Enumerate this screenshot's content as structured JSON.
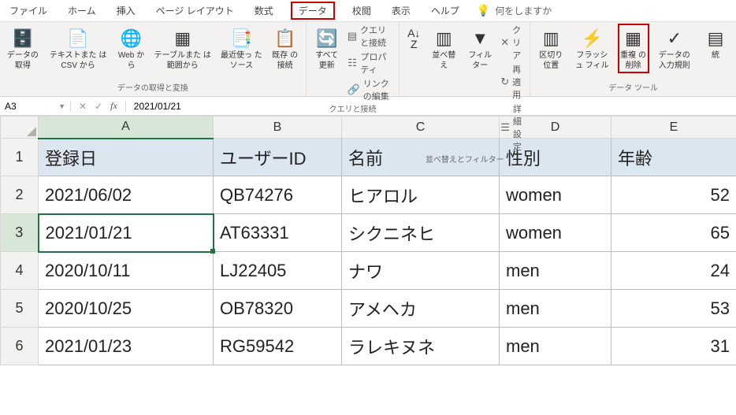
{
  "menu": {
    "file": "ファイル",
    "home": "ホーム",
    "insert": "挿入",
    "pagelayout": "ページ レイアウト",
    "formulas": "数式",
    "data": "データ",
    "review": "校閲",
    "view": "表示",
    "help": "ヘルプ",
    "tellme": "何をしますか"
  },
  "ribbon": {
    "group_getdata": "データの取得と変換",
    "group_queries": "クエリと接続",
    "group_sort": "並べ替えとフィルター",
    "group_tools": "データ ツール",
    "btn_getdata": "データの\n取得",
    "btn_csv": "テキストまた\nは CSV から",
    "btn_web": "Web\nから",
    "btn_table": "テーブルまた\nは範囲から",
    "btn_recent": "最近使っ\nたソース",
    "btn_conn": "既存\nの接続",
    "btn_refresh": "すべて\n更新",
    "btn_q1": "クエリと接続",
    "btn_q2": "プロパティ",
    "btn_q3": "リンクの編集",
    "btn_sort": "並べ替え",
    "btn_filter": "フィルター",
    "btn_clear": "クリア",
    "btn_reapply": "再適用",
    "btn_adv": "詳細設定",
    "btn_texttocols": "区切り位置",
    "btn_flash": "フラッシュ\nフィル",
    "btn_dup": "重複\nの削除",
    "btn_valid": "データの\n入力規則",
    "btn_consol": "統"
  },
  "formula_bar": {
    "cellref": "A3",
    "value": "2021/01/21"
  },
  "columns": [
    "A",
    "B",
    "C",
    "D",
    "E"
  ],
  "header": {
    "A": "登録日",
    "B": "ユーザーID",
    "C": "名前",
    "D": "性別",
    "E": "年齢"
  },
  "rows": [
    {
      "A": "2021/06/02",
      "B": "QB74276",
      "C": "ヒアロル",
      "D": "women",
      "E": "52"
    },
    {
      "A": "2021/01/21",
      "B": "AT63331",
      "C": "シクニネヒ",
      "D": "women",
      "E": "65"
    },
    {
      "A": "2020/10/11",
      "B": "LJ22405",
      "C": "ナワ",
      "D": "men",
      "E": "24"
    },
    {
      "A": "2020/10/25",
      "B": "OB78320",
      "C": "アメヘカ",
      "D": "men",
      "E": "53"
    },
    {
      "A": "2021/01/23",
      "B": "RG59542",
      "C": "ラレキヌネ",
      "D": "men",
      "E": "31"
    }
  ],
  "active_cell": {
    "row": 2,
    "col": 0
  }
}
